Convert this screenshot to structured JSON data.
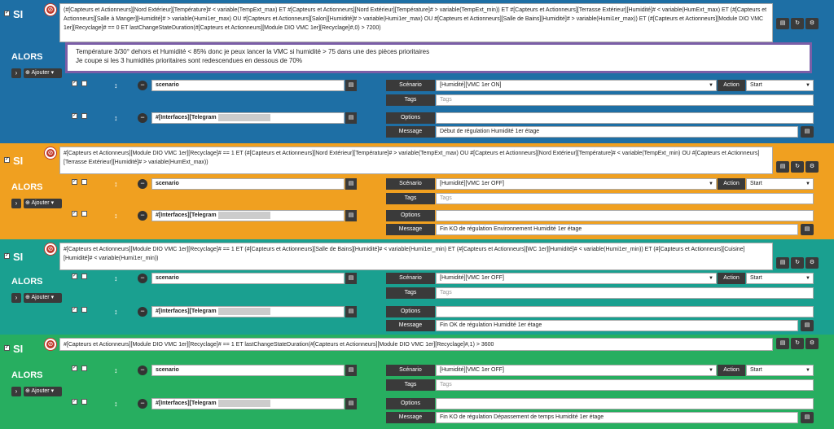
{
  "ui": {
    "si": "SI",
    "alors": "ALORS",
    "add": "Ajouter",
    "scenario_label": "Scénario",
    "action_label": "Action",
    "tags_label": "Tags",
    "tags_placeholder": "Tags",
    "options_label": "Options",
    "message_label": "Message",
    "caret": "▾"
  },
  "blocks": [
    {
      "color": "#1e6fa5",
      "condition": "(#[Capteurs et Actionneurs][Nord Extérieur][Température]# < variable(TempExt_max) ET #[Capteurs et Actionneurs][Nord Extérieur][Température]# > variable(TempExt_min)) ET #[Capteurs et Actionneurs][Terrasse Extérieur][Humidité]# < variable(HumExt_max) ET (#[Capteurs et Actionneurs][Salle à Manger][Humidité]# > variable(Humi1er_max) OU #[Capteurs et Actionneurs][Salon][Humidité]# > variable(Humi1er_max) OU #[Capteurs et Actionneurs][Salle de Bains][Humidité]# > variable(Humi1er_max)) ET (#[Capteurs et Actionneurs][Module DIO VMC 1er][Recyclage]# == 0  ET lastChangeStateDuration(#[Capteurs et Actionneurs][Module DIO VMC 1er][Recyclage]#,0) > 7200)",
      "comment_l1": "Température 3/30° dehors et Humidité < 85% donc je peux lancer la VMC si humidité > 75 dans une des pièces prioritaires",
      "comment_l2": "Je coupe si les 3 humidités prioritaires sont redescendues en dessous de 70%",
      "scenario_field": "scenario",
      "scenario_value": "[Humidité][VMC 1er ON]",
      "action_value": "Start",
      "telegram": "#[Interfaces][Telegram",
      "message": "Début de régulation Humidité 1er étage"
    },
    {
      "color": "#f0a020",
      "condition": "#[Capteurs et Actionneurs][Module DIO VMC 1er][Recyclage]# == 1  ET (#[Capteurs et Actionneurs][Nord Extérieur][Température]# > variable(TempExt_max) OU #[Capteurs et Actionneurs][Nord Extérieur][Température]# < variable(TempExt_min) OU #[Capteurs et Actionneurs][Terrasse Extérieur][Humidité]# > variable(HumExt_max))",
      "scenario_field": "scenario",
      "scenario_value": "[Humidité][VMC 1er OFF]",
      "action_value": "Start",
      "telegram": "#[Interfaces][Telegram",
      "message": "Fin KO de régulation Environnement Humidité 1er étage"
    },
    {
      "color": "#1aa090",
      "condition": "#[Capteurs et Actionneurs][Module DIO VMC 1er][Recyclage]# == 1  ET (#[Capteurs et Actionneurs][Salle de Bains][Humidité]# < variable(Humi1er_min) ET (#[Capteurs et Actionneurs][WC 1er][Humidité]# < variable(Humi1er_min)) ET (#[Capteurs et Actionneurs][Cuisine][Humidité]# < variable(Humi1er_min))",
      "scenario_field": "scenario",
      "scenario_value": "[Humidité][VMC 1er OFF]",
      "action_value": "Start",
      "telegram": "#[Interfaces][Telegram",
      "message": "Fin OK de régulation Humidité 1er étage"
    },
    {
      "color": "#27ae60",
      "condition": "#[Capteurs et Actionneurs][Module DIO VMC 1er][Recyclage]# == 1  ET lastChangeStateDuration(#[Capteurs et Actionneurs][Module DIO VMC 1er][Recyclage]#,1) > 3600",
      "scenario_field": "scenario",
      "scenario_value": "[Humidité][VMC 1er OFF]",
      "action_value": "Start",
      "telegram": "#[Interfaces][Telegram",
      "message": "Fin KO de régulation Dépassement de temps Humidité 1er étage"
    }
  ]
}
